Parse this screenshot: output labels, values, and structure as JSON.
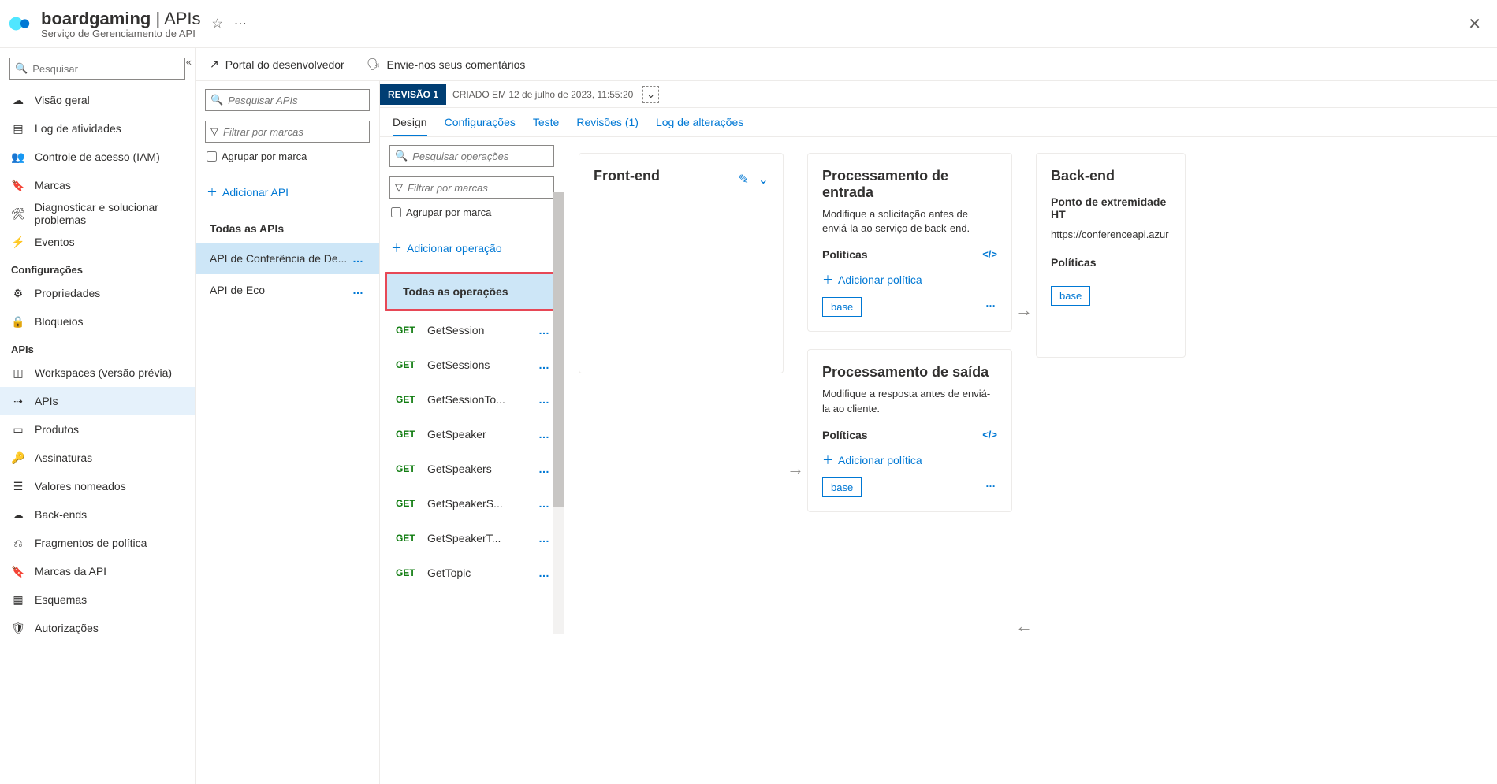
{
  "header": {
    "title_strong": "boardgaming",
    "title_suffix": " | APIs",
    "subtitle": "Serviço de Gerenciamento de API"
  },
  "leftnav": {
    "search_placeholder": "Pesquisar",
    "items_general": [
      {
        "label": "Visão geral",
        "icon": "☁"
      },
      {
        "label": "Log de atividades",
        "icon": "▤"
      },
      {
        "label": "Controle de acesso (IAM)",
        "icon": "👥"
      },
      {
        "label": "Marcas",
        "icon": "🔖"
      },
      {
        "label": "Diagnosticar e solucionar problemas",
        "icon": "🛠"
      },
      {
        "label": "Eventos",
        "icon": "⚡"
      }
    ],
    "section_config": "Configurações",
    "items_config": [
      {
        "label": "Propriedades",
        "icon": "⚙"
      },
      {
        "label": "Bloqueios",
        "icon": "🔒"
      }
    ],
    "section_apis": "APIs",
    "items_apis": [
      {
        "label": "Workspaces (versão prévia)",
        "icon": "◫",
        "active": false
      },
      {
        "label": "APIs",
        "icon": "⇢",
        "active": true
      },
      {
        "label": "Produtos",
        "icon": "▭",
        "active": false
      },
      {
        "label": "Assinaturas",
        "icon": "🔑",
        "active": false
      },
      {
        "label": "Valores nomeados",
        "icon": "☰",
        "active": false
      },
      {
        "label": "Back-ends",
        "icon": "☁",
        "active": false
      },
      {
        "label": "Fragmentos de política",
        "icon": "⎌",
        "active": false
      },
      {
        "label": "Marcas da API",
        "icon": "🔖",
        "active": false
      },
      {
        "label": "Esquemas",
        "icon": "▦",
        "active": false
      },
      {
        "label": "Autorizações",
        "icon": "🛡",
        "active": false
      }
    ]
  },
  "topbar": {
    "dev_portal": "Portal do desenvolvedor",
    "feedback": "Envie-nos seus comentários"
  },
  "api_col": {
    "search_placeholder": "Pesquisar APIs",
    "filter_placeholder": "Filtrar por marcas",
    "group_label": "Agrupar por marca",
    "add_label": "Adicionar API",
    "all_label": "Todas as APIs",
    "apis": [
      {
        "label": "API de Conferência de De...",
        "active": true
      },
      {
        "label": "API de Eco",
        "active": false
      }
    ]
  },
  "revision": {
    "badge": "REVISÃO 1",
    "info": "CRIADO EM 12 de julho de 2023, 11:55:20"
  },
  "tabs": [
    "Design",
    "Configurações",
    "Teste",
    "Revisões (1)",
    "Log de alterações"
  ],
  "ops_col": {
    "search_placeholder": "Pesquisar operações",
    "filter_placeholder": "Filtrar por marcas",
    "group_label": "Agrupar por marca",
    "add_label": "Adicionar operação",
    "all_label": "Todas as operações",
    "ops": [
      {
        "method": "GET",
        "name": "GetSession"
      },
      {
        "method": "GET",
        "name": "GetSessions"
      },
      {
        "method": "GET",
        "name": "GetSessionTo..."
      },
      {
        "method": "GET",
        "name": "GetSpeaker"
      },
      {
        "method": "GET",
        "name": "GetSpeakers"
      },
      {
        "method": "GET",
        "name": "GetSpeakerS..."
      },
      {
        "method": "GET",
        "name": "GetSpeakerT..."
      },
      {
        "method": "GET",
        "name": "GetTopic"
      }
    ]
  },
  "panels": {
    "frontend_title": "Front-end",
    "inbound_title": "Processamento de entrada",
    "inbound_desc": "Modifique a solicitação antes de enviá-la ao serviço de back-end.",
    "outbound_title": "Processamento de saída",
    "outbound_desc": "Modifique a resposta antes de enviá-la ao cliente.",
    "backend_title": "Back-end",
    "backend_endpoint_lbl": "Ponto de extremidade HT",
    "backend_url": "https://conferenceapi.azur",
    "policies_lbl": "Políticas",
    "add_policy_lbl": "Adicionar política",
    "base_tag": "base"
  }
}
